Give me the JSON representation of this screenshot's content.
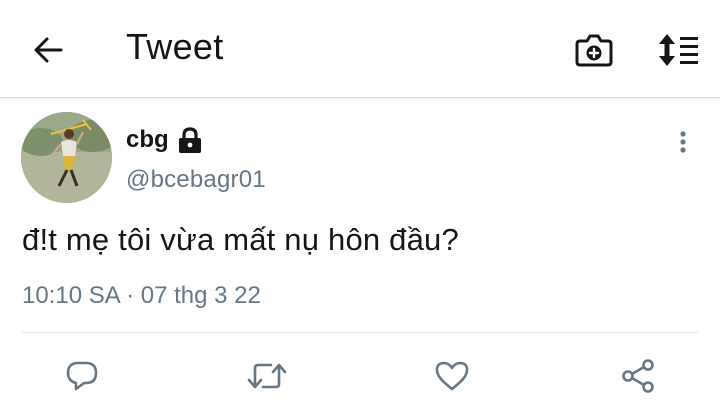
{
  "header": {
    "title": "Tweet",
    "back_icon": "arrow-left-icon",
    "camera_icon": "camera-plus-icon",
    "sort_icon": "sort-icon"
  },
  "tweet": {
    "author_name": "cbg",
    "author_handle": "@bcebagr01",
    "protected_icon": "lock-icon",
    "text": "đ!t mẹ tôi vừa mất nụ hôn đầu?",
    "timestamp": "10:10 SA · 07 thg 3 22",
    "more_icon": "more-vertical-icon"
  },
  "actions": {
    "reply_icon": "reply-icon",
    "retweet_icon": "retweet-icon",
    "like_icon": "heart-icon",
    "share_icon": "share-icon"
  },
  "colors": {
    "primary_text": "#14171a",
    "secondary_text": "#657786",
    "action_icon": "#657786"
  }
}
